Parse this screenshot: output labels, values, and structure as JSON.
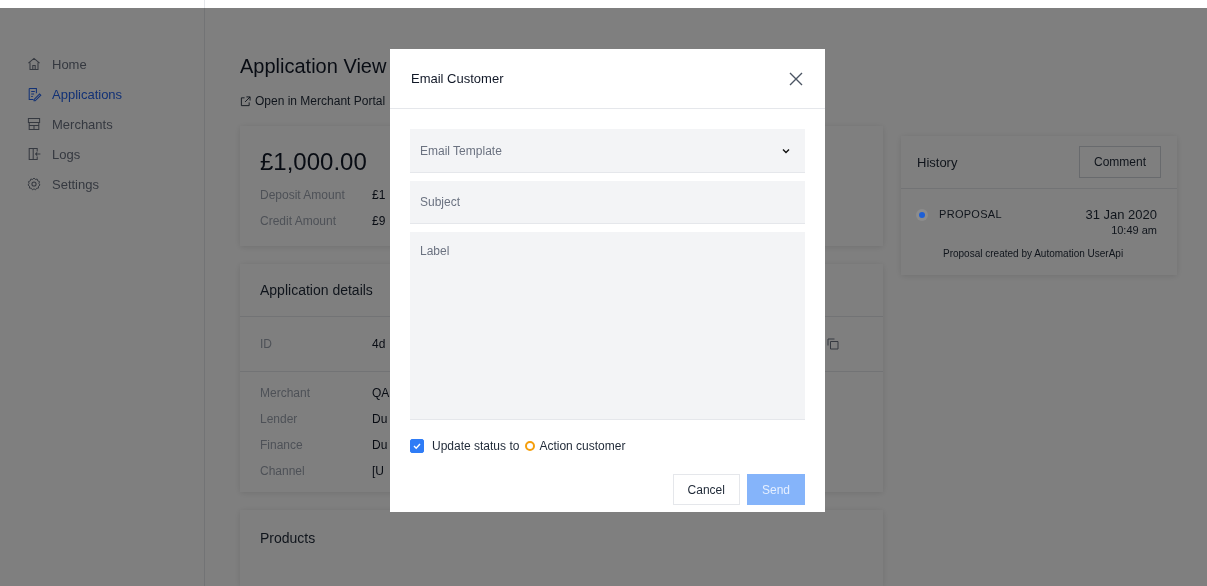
{
  "sidebar": {
    "items": [
      {
        "label": "Home",
        "selected": false
      },
      {
        "label": "Applications",
        "selected": true
      },
      {
        "label": "Merchants",
        "selected": false
      },
      {
        "label": "Logs",
        "selected": false
      },
      {
        "label": "Settings",
        "selected": false
      }
    ]
  },
  "page": {
    "title": "Application View",
    "portal_link": "Open in Merchant Portal"
  },
  "summary_card": {
    "amount": "£1,000.00",
    "rows": [
      {
        "label": "Deposit Amount",
        "value": "£1"
      },
      {
        "label": "Credit Amount",
        "value": "£9"
      }
    ]
  },
  "details_card": {
    "title": "Application details",
    "id_row": {
      "label": "ID",
      "value": "4d"
    },
    "rows": [
      {
        "label": "Merchant",
        "value": "QA"
      },
      {
        "label": "Lender",
        "value": "Du"
      },
      {
        "label": "Finance",
        "value": "Du"
      },
      {
        "label": "Channel",
        "value": "[U"
      }
    ]
  },
  "products_card": {
    "title": "Products"
  },
  "history": {
    "title": "History",
    "comment_button": "Comment",
    "entries": [
      {
        "status": "PROPOSAL",
        "color": "#1d5fd6",
        "date": "31 Jan 2020",
        "time": "10:49 am",
        "description": "Proposal created by Automation UserApi"
      }
    ]
  },
  "modal": {
    "title": "Email Customer",
    "template_select": {
      "placeholder": "Email Template"
    },
    "subject": {
      "placeholder": "Subject"
    },
    "body": {
      "placeholder": "Label"
    },
    "update_status": {
      "checked": true,
      "prefix": "Update status to",
      "status": "Action customer",
      "color": "#f59e0b"
    },
    "buttons": [
      {
        "label": "Cancel",
        "kind": "secondary",
        "disabled": false
      },
      {
        "label": "Send",
        "kind": "primary",
        "disabled": true
      }
    ]
  }
}
